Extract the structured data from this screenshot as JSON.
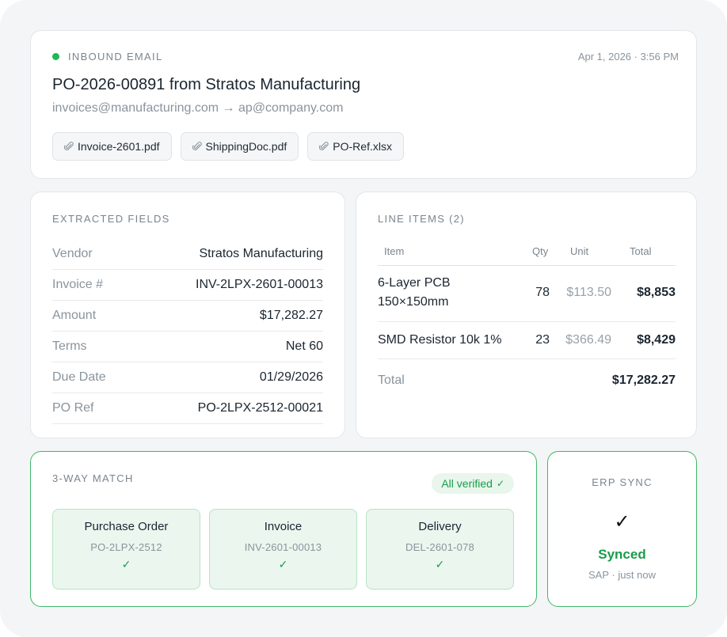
{
  "email": {
    "label": "INBOUND EMAIL",
    "timestamp": "Apr 1, 2026 · 3:56 PM",
    "subject": "PO-2026-00891 from Stratos Manufacturing",
    "route": "invoices@manufacturing.com → ap@company.com",
    "attachments": [
      "Invoice-2601.pdf",
      "ShippingDoc.pdf",
      "PO-Ref.xlsx"
    ],
    "status_color": "#1db954"
  },
  "fields": {
    "label": "EXTRACTED FIELDS",
    "rows": [
      {
        "key": "Vendor",
        "value": "Stratos Manufacturing"
      },
      {
        "key": "Invoice #",
        "value": "INV-2LPX-2601-00013"
      },
      {
        "key": "Amount",
        "value": "$17,282.27"
      },
      {
        "key": "Terms",
        "value": "Net 60"
      },
      {
        "key": "Due Date",
        "value": "01/29/2026"
      },
      {
        "key": "PO Ref",
        "value": "PO-2LPX-2512-00021"
      }
    ]
  },
  "line_items": {
    "label": "LINE ITEMS (2)",
    "headers": {
      "item": "Item",
      "qty": "Qty",
      "unit": "Unit",
      "total": "Total"
    },
    "rows": [
      {
        "item_line1": "6-Layer PCB",
        "item_line2": "150×150mm",
        "qty": "78",
        "unit": "$113.50",
        "total": "$8,853"
      },
      {
        "item_line1": "SMD Resistor 10k 1%",
        "item_line2": "",
        "qty": "23",
        "unit": "$366.49",
        "total": "$8,429"
      }
    ],
    "total_label": "Total",
    "total_value": "$17,282.27"
  },
  "match": {
    "label": "3-WAY MATCH",
    "badge": "All verified",
    "badge_check": "✓",
    "accent": "#1a9c4a",
    "docs": [
      {
        "title": "Purchase Order",
        "ref": "PO-2LPX-2512",
        "check": "✓"
      },
      {
        "title": "Invoice",
        "ref": "INV-2601-00013",
        "check": "✓"
      },
      {
        "title": "Delivery",
        "ref": "DEL-2601-078",
        "check": "✓"
      }
    ]
  },
  "erp": {
    "label": "ERP SYNC",
    "check": "✓",
    "status": "Synced",
    "sub": "SAP · just now"
  },
  "icons": {
    "attachment": "paperclip-icon",
    "status": "status-dot-icon",
    "check": "check-icon"
  }
}
